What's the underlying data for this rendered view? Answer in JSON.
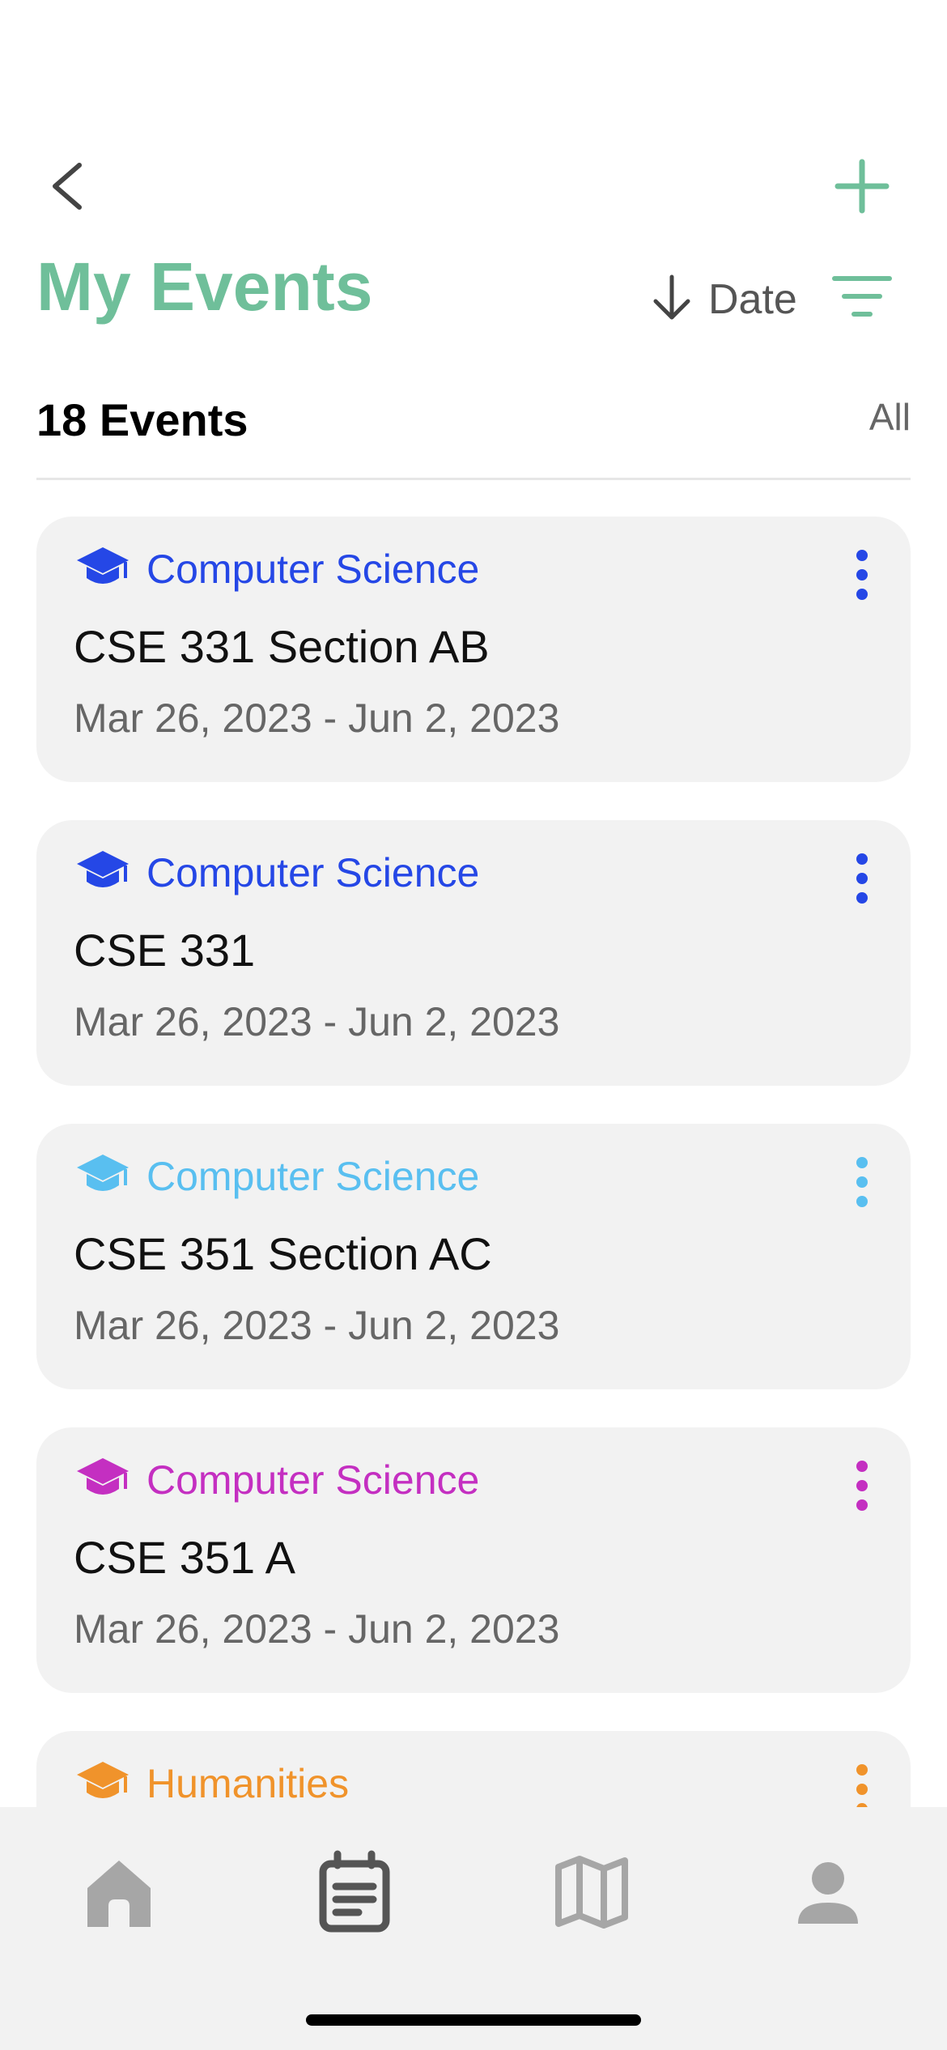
{
  "header": {
    "title": "My Events",
    "sort_label": "Date",
    "accent_color": "#6fbf9a"
  },
  "summary": {
    "count_label": "18 Events",
    "filter_scope": "All"
  },
  "events": [
    {
      "category": "Computer Science",
      "name": "CSE 331 Section AB",
      "dates": "Mar 26, 2023 - Jun 2, 2023",
      "color": "#2547e6",
      "icon": "graduation-cap-icon"
    },
    {
      "category": "Computer Science",
      "name": "CSE 331",
      "dates": "Mar 26, 2023 - Jun 2, 2023",
      "color": "#2547e6",
      "icon": "graduation-cap-icon"
    },
    {
      "category": "Computer Science",
      "name": "CSE 351 Section AC",
      "dates": "Mar 26, 2023 - Jun 2, 2023",
      "color": "#59bff0",
      "icon": "graduation-cap-icon"
    },
    {
      "category": "Computer Science",
      "name": "CSE 351 A",
      "dates": "Mar 26, 2023 - Jun 2, 2023",
      "color": "#c42fc1",
      "icon": "graduation-cap-icon"
    },
    {
      "category": "Humanities",
      "name": "",
      "dates": "",
      "color": "#f0932b",
      "icon": "graduation-cap-icon"
    }
  ],
  "tab_bar": {
    "tabs": [
      {
        "icon": "home-icon",
        "active": false
      },
      {
        "icon": "calendar-icon",
        "active": true
      },
      {
        "icon": "map-icon",
        "active": false
      },
      {
        "icon": "profile-icon",
        "active": false
      }
    ],
    "active_color": "#555555",
    "inactive_color": "#a6a6a6"
  }
}
